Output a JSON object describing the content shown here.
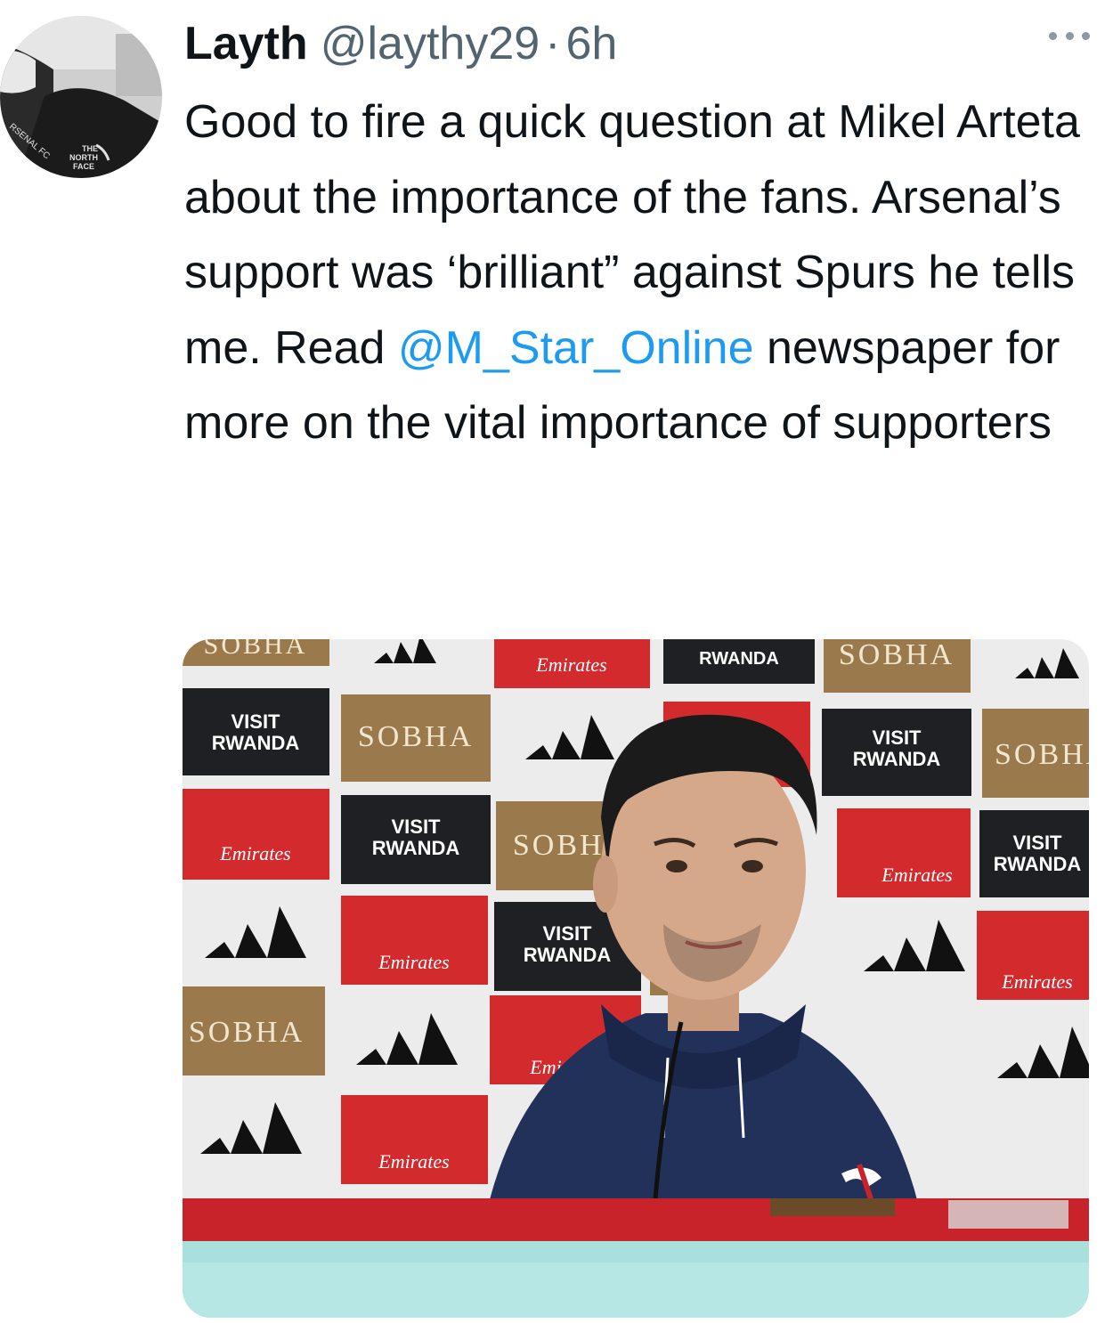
{
  "tweet": {
    "author_name": "Layth",
    "handle": "@laythy29",
    "separator": "·",
    "time": "6h",
    "text_before_mention": "Good to fire a quick question at Mikel Arteta about the importance of the fans. Arsenal’s support was ‘brilliant” against Spurs he tells me. Read ",
    "mention": "@M_Star_Online",
    "text_after_mention": " newspaper for more on the vital importance of supporters"
  },
  "avatar": {
    "jacket_text_1": "RSENAL FC",
    "jacket_text_2": "THE",
    "jacket_text_3": "NORTH",
    "jacket_text_4": "FACE"
  },
  "backdrop": {
    "sobha": "SOBHA",
    "emirates": "Emirates",
    "visit": "VISIT",
    "rwanda": "RWANDA",
    "colors": {
      "black_tile": "#1f2024",
      "gold_tile": "#9a7a4c",
      "red_tile": "#d32a2e",
      "white_tile": "#f2f2f2",
      "hoodie": "#22315a",
      "desk": "#c8232b",
      "table": "#a9e0dd"
    }
  },
  "icons": {
    "more": "more-horizontal-icon",
    "brand": "adidas-logo"
  }
}
